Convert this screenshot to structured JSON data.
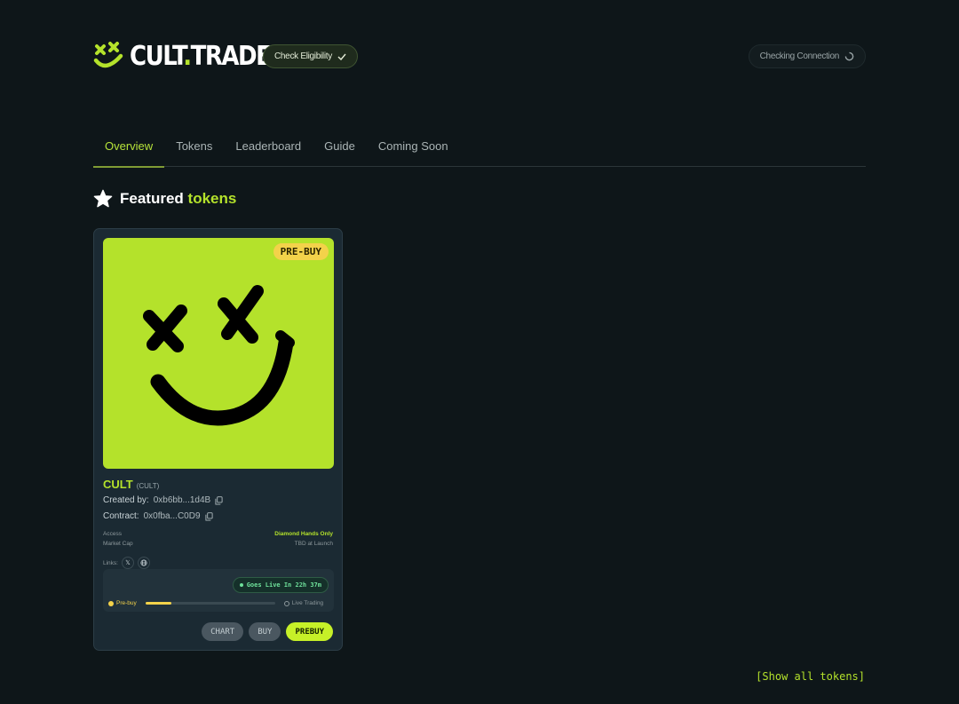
{
  "header": {
    "logo_text_a": "CULT",
    "logo_text_dot": ".",
    "logo_text_b": "TRADE",
    "check_eligibility_label": "Check Eligibility",
    "connection_label": "Checking Connection"
  },
  "nav": {
    "tabs": [
      {
        "label": "Overview",
        "active": true
      },
      {
        "label": "Tokens",
        "active": false
      },
      {
        "label": "Leaderboard",
        "active": false
      },
      {
        "label": "Guide",
        "active": false
      },
      {
        "label": "Coming Soon",
        "active": false
      }
    ]
  },
  "featured": {
    "title_a": "Featured",
    "title_b": "tokens"
  },
  "card": {
    "badge": "PRE-BUY",
    "name": "CULT",
    "ticker": "(CULT)",
    "created_by_label": "Created by:",
    "created_by_value": "0xb6bb...1d4B",
    "contract_label": "Contract:",
    "contract_value": "0x0fba...C0D9",
    "access_label": "Access",
    "access_value": "Diamond Hands Only",
    "market_cap_label": "Market Cap",
    "market_cap_value": "TBD at Launch",
    "links_label": "Links:",
    "live_status": "Goes Live In 22h 37m",
    "stage_prebuy": "Pre-buy",
    "stage_live": "Live Trading",
    "progress_fraction": 0.2,
    "buttons": {
      "chart": "CHART",
      "buy": "BUY",
      "prebuy": "PREBUY"
    }
  },
  "show_all": "[Show all tokens]",
  "colors": {
    "accent": "#b4e22b",
    "badge": "#f3d24a",
    "background": "#0e1619"
  }
}
